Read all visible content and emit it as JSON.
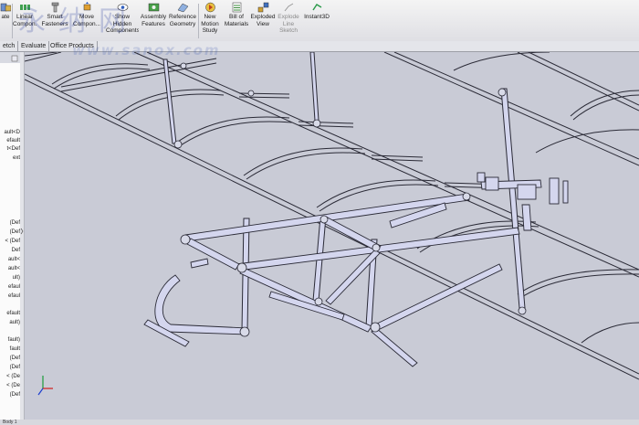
{
  "toolbar": {
    "items": [
      {
        "label": "ate",
        "icon": "mate-icon"
      },
      {
        "label": "Linear Compon...",
        "icon": "linear-pattern-icon"
      },
      {
        "label": "Smart Fasteners",
        "icon": "smart-fasteners-icon"
      },
      {
        "label": "Move Compon...",
        "icon": "move-component-icon"
      },
      {
        "label": "Show Hidden Components",
        "icon": "show-hidden-icon"
      },
      {
        "label": "Assembly Features",
        "icon": "assembly-features-icon"
      },
      {
        "label": "Reference Geometry",
        "icon": "reference-geometry-icon"
      },
      {
        "label": "New Motion Study",
        "icon": "motion-study-icon"
      },
      {
        "label": "Bill of Materials",
        "icon": "bom-icon"
      },
      {
        "label": "Exploded View",
        "icon": "exploded-view-icon"
      },
      {
        "label": "Explode Line Sketch",
        "icon": "explode-line-icon"
      },
      {
        "label": "Instant3D",
        "icon": "instant3d-icon"
      }
    ]
  },
  "tabs": [
    "etch",
    "Evaluate",
    "Office Products"
  ],
  "tree_items": [
    "ault<D",
    "efault",
    "t<Def",
    "ext",
    "(Def",
    "(Def",
    "< (Def",
    "Def",
    "ault<",
    "ault<",
    "ult)",
    "efaul",
    "efaul",
    "efault",
    "ault)",
    "fault)",
    "fault",
    "(Def",
    "(Def",
    "< (De",
    "< (De",
    "(Def"
  ],
  "watermark": {
    "cn": "永纳网",
    "url": "www.sanox.com"
  },
  "status": "Body 1",
  "colors": {
    "viewport_bg": "#c9cbd6",
    "tube_fill": "#d4d6ee",
    "tube_edge": "#2a2a36"
  }
}
